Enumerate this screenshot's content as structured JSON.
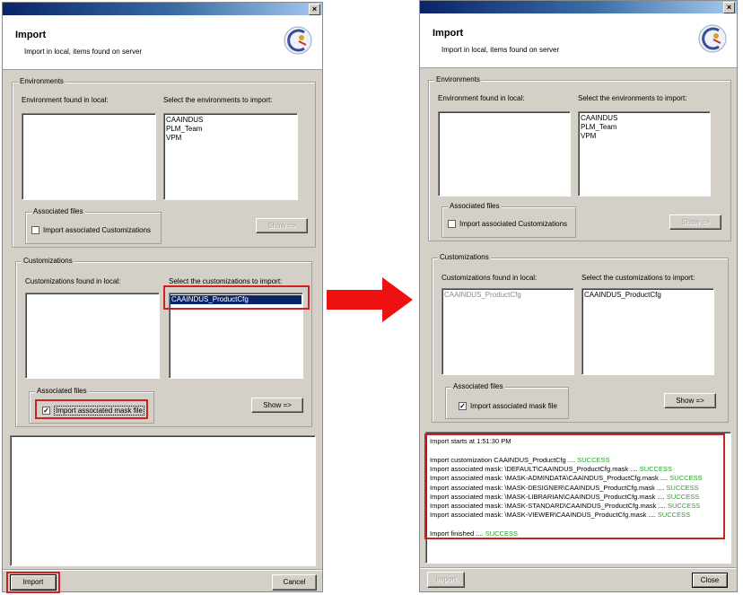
{
  "before": {
    "title": "Import",
    "subtitle": "Import in local, items found on server",
    "environments": {
      "legend": "Environments",
      "found_label": "Environment found in local:",
      "select_label": "Select the environments to import:",
      "found_items": [],
      "select_items": [
        "CAAINDUS",
        "PLM_Team",
        "VPM"
      ],
      "assoc_legend": "Associated files",
      "assoc_checkbox": "Import associated Customizations",
      "assoc_checked": false,
      "show_button": "Show =>"
    },
    "customizations": {
      "legend": "Customizations",
      "found_label": "Customizations found in local:",
      "select_label": "Select the customizations to import:",
      "found_items": [],
      "select_items": [
        "CAAINDUS_ProductCfg"
      ],
      "selected_item": "CAAINDUS_ProductCfg",
      "assoc_legend": "Associated files",
      "assoc_checkbox": "Import associated mask file",
      "assoc_checked": true,
      "show_button": "Show =>"
    },
    "import_button": "Import",
    "cancel_button": "Cancel"
  },
  "after": {
    "title": "Import",
    "subtitle": "Import in local, items found on server",
    "environments": {
      "legend": "Environments",
      "found_label": "Environment found in local:",
      "select_label": "Select the environments to import:",
      "found_items": [],
      "select_items": [
        "CAAINDUS",
        "PLM_Team",
        "VPM"
      ],
      "assoc_legend": "Associated files",
      "assoc_checkbox": "Import associated Customizations",
      "assoc_checked": false,
      "show_button": "Show =>"
    },
    "customizations": {
      "legend": "Customizations",
      "found_label": "Customizations found in local:",
      "select_label": "Select the customizations to import:",
      "found_items": [
        "CAAINDUS_ProductCfg"
      ],
      "select_items": [
        "CAAINDUS_ProductCfg"
      ],
      "assoc_legend": "Associated files",
      "assoc_checkbox": "Import associated mask file",
      "assoc_checked": true,
      "show_button": "Show =>"
    },
    "log": [
      {
        "text": "Import starts at 1:51:30 PM",
        "status": ""
      },
      {
        "text": "",
        "status": ""
      },
      {
        "text": "Import customization CAAINDUS_ProductCfg  .... ",
        "status": "SUCCESS"
      },
      {
        "text": "Import associated mask: \\DEFAULT\\CAAINDUS_ProductCfg.mask  .... ",
        "status": "SUCCESS"
      },
      {
        "text": "Import associated mask: \\MASK-ADMINDATA\\CAAINDUS_ProductCfg.mask  .... ",
        "status": "SUCCESS"
      },
      {
        "text": "Import associated mask: \\MASK-DESIGNER\\CAAINDUS_ProductCfg.mask  .... ",
        "status": "SUCCESS"
      },
      {
        "text": "Import associated mask: \\MASK-LIBRARIAN\\CAAINDUS_ProductCfg.mask  .... ",
        "status": "SUCCESS"
      },
      {
        "text": "Import associated mask: \\MASK-STANDARD\\CAAINDUS_ProductCfg.mask  .... ",
        "status": "SUCCESS"
      },
      {
        "text": "Import associated mask: \\MASK-VIEWER\\CAAINDUS_ProductCfg.mask  .... ",
        "status": "SUCCESS"
      },
      {
        "text": "",
        "status": ""
      },
      {
        "text": "Import finished  .... ",
        "status": "SUCCESS"
      }
    ],
    "import_button": "Import",
    "close_button": "Close"
  },
  "close_glyph": "×",
  "colors": {
    "highlight": "#cc2222",
    "success": "#2e9e2e",
    "selection": "#0a246a"
  }
}
